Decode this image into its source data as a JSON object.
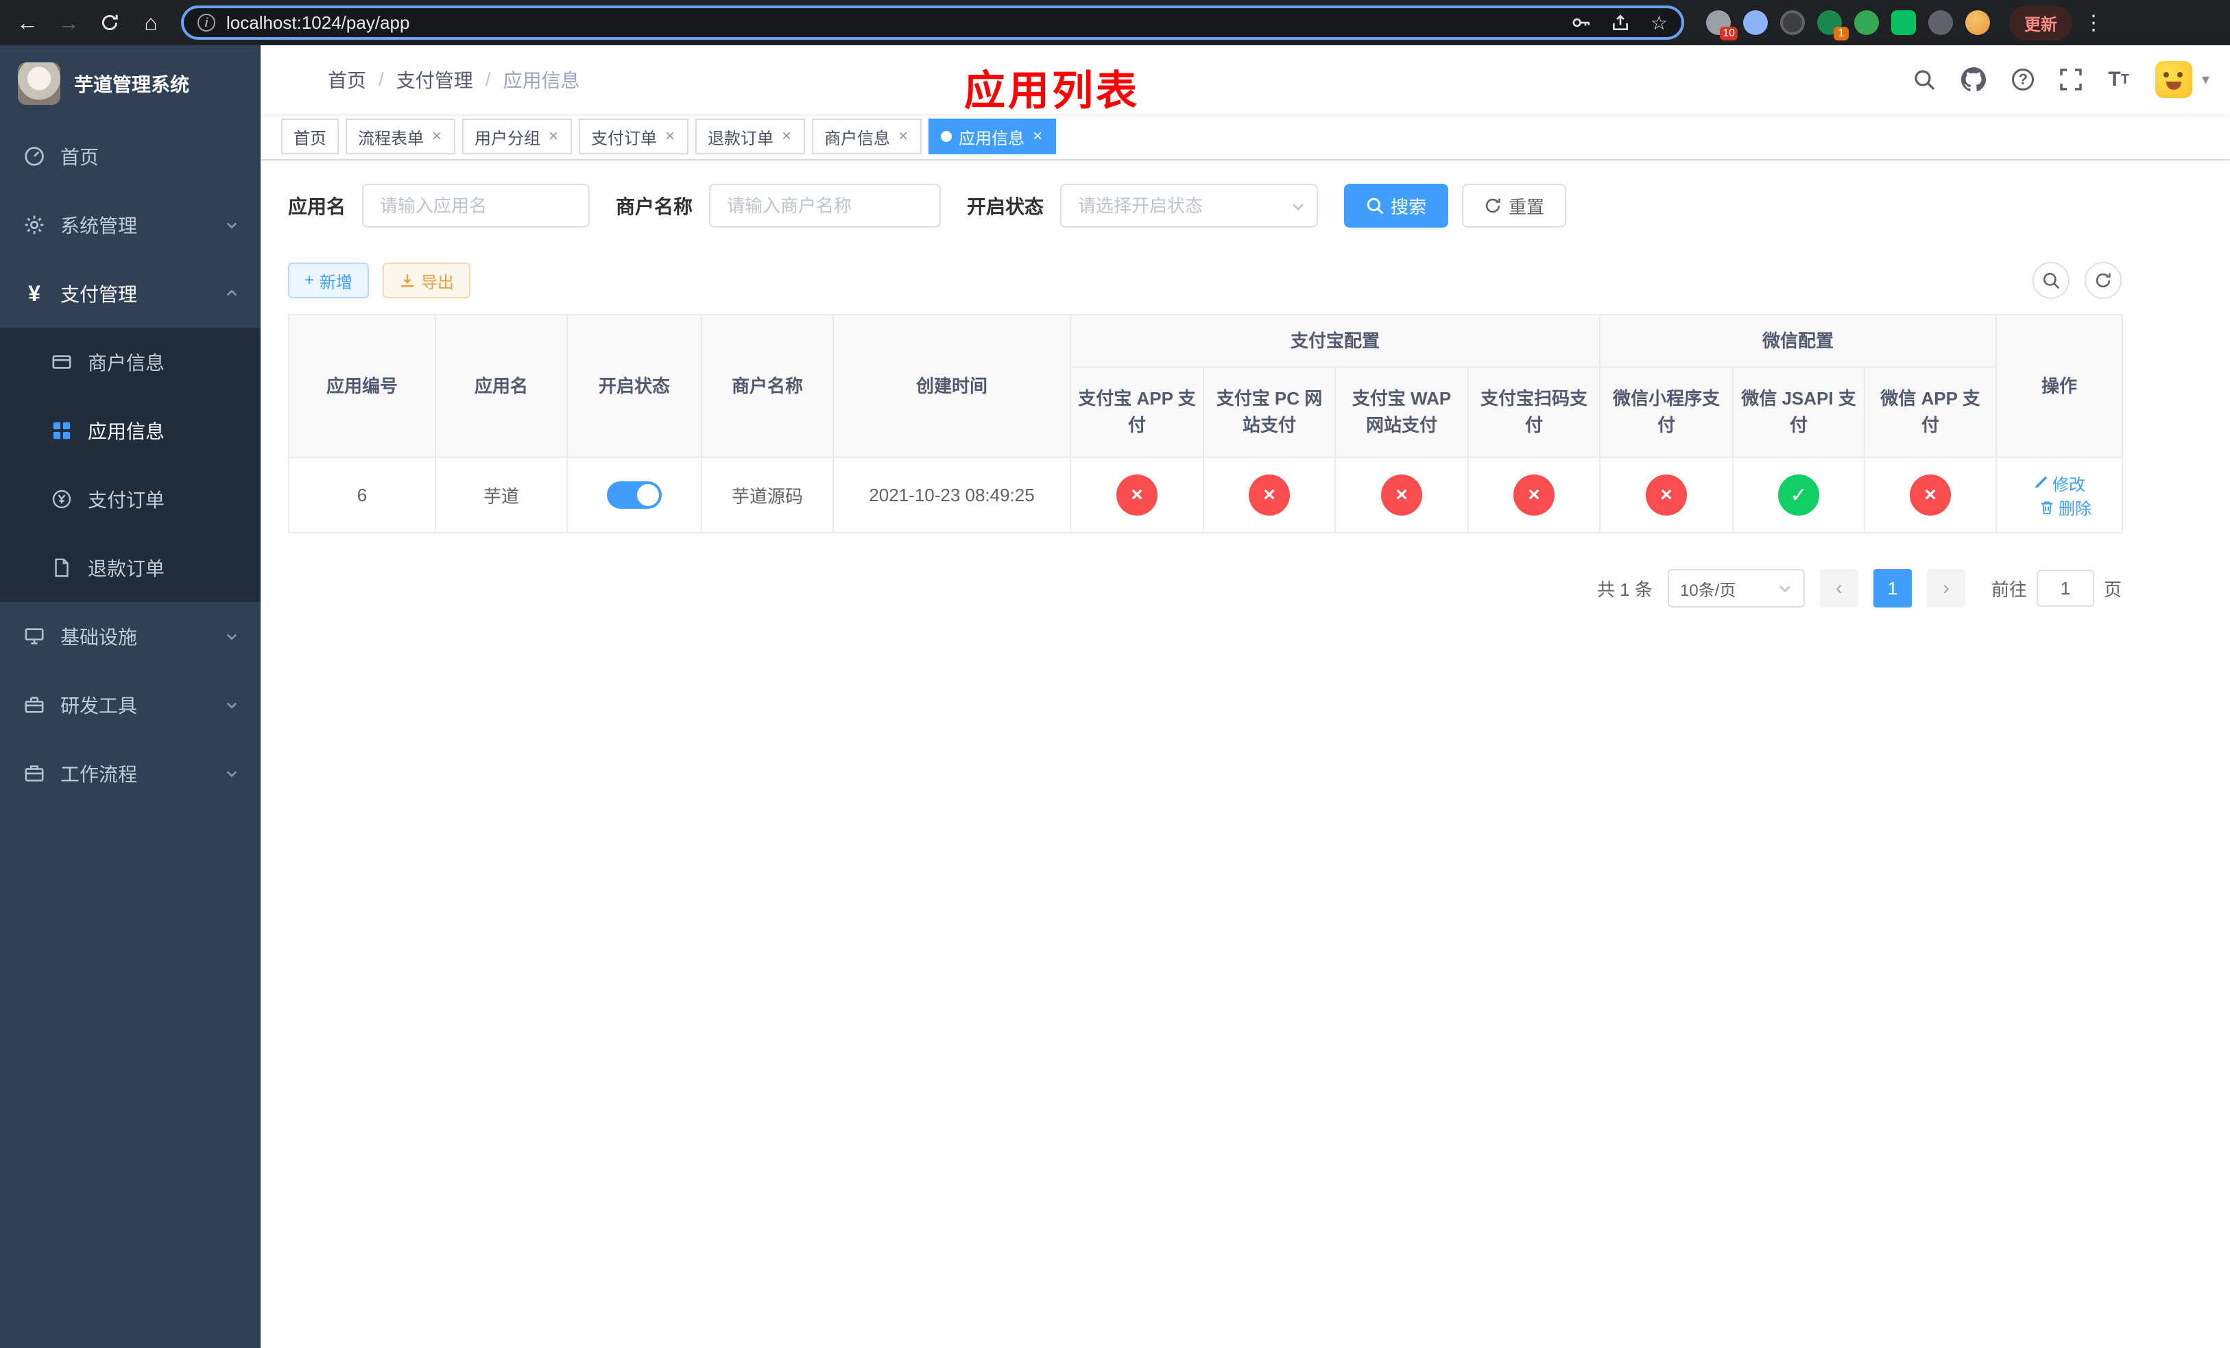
{
  "browser": {
    "url": "localhost:1024/pay/app",
    "update_button": "更新",
    "extension_badges": {
      "puzzle": "10",
      "green": "1"
    }
  },
  "icons": {
    "back": "←",
    "forward": "→",
    "home": "⌂",
    "bookmark": "☆",
    "menu_dots": "⋮",
    "caret": "▾",
    "prev": "‹",
    "next": "›",
    "plus": "+",
    "close": "×",
    "info": "i"
  },
  "sidebar": {
    "logo_title": "芋道管理系统",
    "items": {
      "home": "首页",
      "system": "系统管理",
      "payment": "支付管理",
      "merchant": "商户信息",
      "app": "应用信息",
      "pay_order": "支付订单",
      "refund_order": "退款订单",
      "infra": "基础设施",
      "dev_tools": "研发工具",
      "workflow": "工作流程"
    }
  },
  "header": {
    "breadcrumb": {
      "home": "首页",
      "payment": "支付管理",
      "current": "应用信息"
    },
    "page_title": "应用列表"
  },
  "tabs": [
    {
      "label": "首页",
      "closable": false,
      "active": false
    },
    {
      "label": "流程表单",
      "closable": true,
      "active": false
    },
    {
      "label": "用户分组",
      "closable": true,
      "active": false
    },
    {
      "label": "支付订单",
      "closable": true,
      "active": false
    },
    {
      "label": "退款订单",
      "closable": true,
      "active": false
    },
    {
      "label": "商户信息",
      "closable": true,
      "active": false
    },
    {
      "label": "应用信息",
      "closable": true,
      "active": true
    }
  ],
  "filters": {
    "app_name_label": "应用名",
    "app_name_placeholder": "请输入应用名",
    "merchant_label": "商户名称",
    "merchant_placeholder": "请输入商户名称",
    "status_label": "开启状态",
    "status_placeholder": "请选择开启状态",
    "search_button": "搜索",
    "reset_button": "重置"
  },
  "toolbar": {
    "add_button": "新增",
    "export_button": "导出"
  },
  "table": {
    "group_headers": {
      "alipay": "支付宝配置",
      "wechat": "微信配置"
    },
    "columns": [
      "应用编号",
      "应用名",
      "开启状态",
      "商户名称",
      "创建时间",
      "支付宝 APP 支付",
      "支付宝 PC 网站支付",
      "支付宝 WAP 网站支付",
      "支付宝扫码支付",
      "微信小程序支付",
      "微信 JSAPI 支付",
      "微信 APP 支付",
      "操作"
    ],
    "rows": [
      {
        "id": "6",
        "app_name": "芋道",
        "enabled": true,
        "merchant_name": "芋道源码",
        "created_at": "2021-10-23 08:49:25",
        "alipay_app": false,
        "alipay_pc": false,
        "alipay_wap": false,
        "alipay_qr": false,
        "wx_mini": false,
        "wx_jsapi": true,
        "wx_app": false,
        "actions": {
          "edit": "修改",
          "delete": "删除"
        }
      }
    ]
  },
  "pagination": {
    "total": "共 1 条",
    "page_size": "10条/页",
    "page": "1",
    "goto_prefix": "前往",
    "goto_value": "1",
    "goto_suffix": "页"
  }
}
